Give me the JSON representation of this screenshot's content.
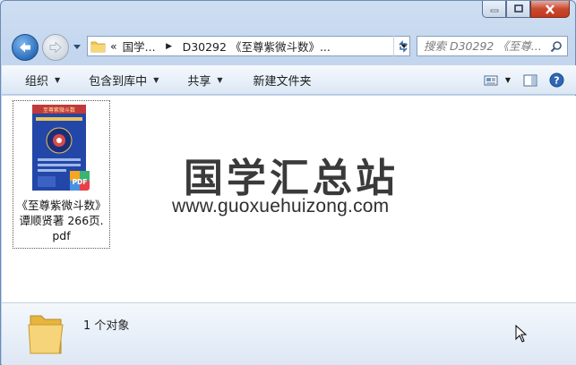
{
  "address": {
    "crumbs": [
      "«",
      "国学...",
      "D30292 《至尊紫微斗数》..."
    ]
  },
  "search": {
    "placeholder": "搜索 D30292 《至尊..."
  },
  "commands": {
    "organize": "组织",
    "include_in_library": "包含到库中",
    "share": "共享",
    "new_folder": "新建文件夹"
  },
  "file": {
    "name_line1": "《至尊紫微斗数》",
    "name_line2": "谭顺贤著 266页.",
    "name_line3": "pdf",
    "badge": "PDF",
    "cover_title": "至尊紫微斗数"
  },
  "watermark": {
    "cn": "国学汇总站",
    "en": "www.guoxuehuizong.com"
  },
  "status": {
    "item_count": "1 个对象"
  },
  "colors": {
    "accent": "#2b6fbd",
    "pdf_badge": "#e8404a",
    "cover": "#2347a8"
  },
  "icons": [
    "minimize-icon",
    "maximize-icon",
    "close-icon",
    "back-arrow-icon",
    "forward-arrow-icon",
    "folder-icon",
    "refresh-icon",
    "search-icon",
    "view-icon",
    "preview-pane-icon",
    "help-icon",
    "pdf-icon",
    "mouse-cursor-icon"
  ]
}
